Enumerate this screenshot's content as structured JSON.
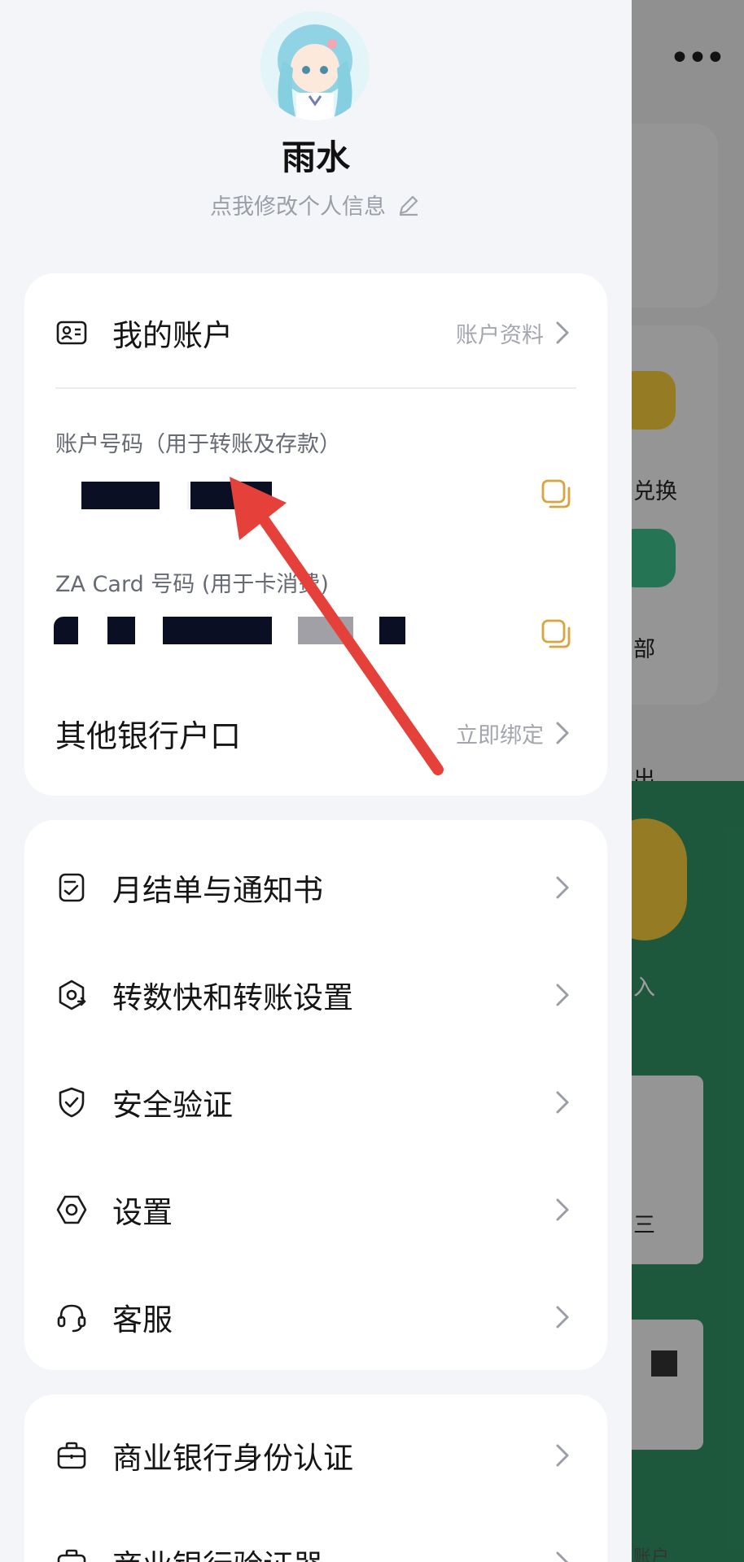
{
  "user": {
    "name": "雨水",
    "edit_profile": "点我修改个人信息"
  },
  "account_card": {
    "title": "我的账户",
    "action": "账户资料",
    "account_number_label": "账户号码（用于转账及存款）",
    "za_card_label": "ZA Card 号码 (用于卡消费)",
    "other_banks_title": "其他银行户口",
    "other_banks_action": "立即绑定"
  },
  "menu": {
    "items": [
      {
        "label": "月结单与通知书",
        "icon": "statement-icon"
      },
      {
        "label": "转数快和转账设置",
        "icon": "transfer-settings-icon"
      },
      {
        "label": "安全验证",
        "icon": "shield-check-icon"
      },
      {
        "label": "设置",
        "icon": "settings-hexagon-icon"
      },
      {
        "label": "客服",
        "icon": "headset-icon"
      }
    ]
  },
  "business": {
    "items": [
      {
        "label": "商业银行身份认证",
        "icon": "briefcase-icon"
      },
      {
        "label": "商业银行验证器",
        "icon": "briefcase-icon"
      }
    ]
  },
  "background": {
    "labels": [
      "兑换",
      "部",
      "出",
      "入",
      "三",
      "账户"
    ]
  },
  "colors": {
    "accent_gold": "#d9a440",
    "arrow_red": "#e5403a",
    "bg_green": "#2f8f63"
  }
}
